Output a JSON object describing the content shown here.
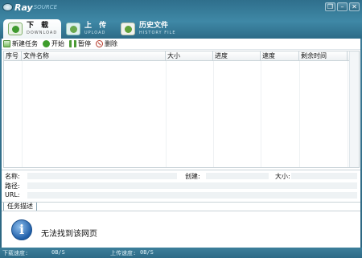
{
  "app": {
    "logo_ray": "Ray",
    "logo_source": "SOURCE"
  },
  "window_controls": [
    {
      "name": "restore-icon",
      "glyph": "❐"
    },
    {
      "name": "minimize-icon",
      "glyph": "–"
    },
    {
      "name": "close-icon",
      "glyph": "✕"
    }
  ],
  "tabs": {
    "download": {
      "label": "下 载",
      "sub": "DOWNLOAD"
    },
    "upload": {
      "label": "上 传",
      "sub": "UPLOAD"
    },
    "history": {
      "label": "历史文件",
      "sub": "HISTORY FILE"
    }
  },
  "toolbar": {
    "new_task": "新建任务",
    "start": "开始",
    "pause": "暂停",
    "delete": "删除"
  },
  "table": {
    "columns": [
      "序号",
      "文件名称",
      "大小",
      "进度",
      "速度",
      "剩余时间"
    ],
    "rows": []
  },
  "details": {
    "name_label": "名称:",
    "created_label": "创建:",
    "size_label": "大小:",
    "path_label": "路径:",
    "url_label": "URL:"
  },
  "task_desc": {
    "tab_label": "任务描述",
    "message": "无法找到该网页"
  },
  "status_bar": {
    "download_speed_label": "下载速度:",
    "download_speed_value": "0B/S",
    "upload_speed_label": "上传速度:",
    "upload_speed_value": "0B/S"
  },
  "colors": {
    "header_blue": "#3f88a6",
    "accent_green": "#3e9d2c"
  }
}
